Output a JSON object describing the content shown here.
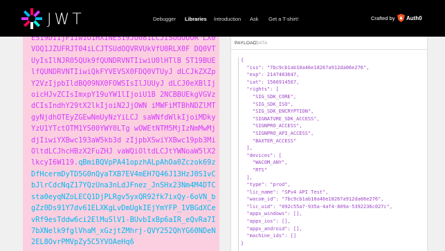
{
  "navbar": {
    "logo_text": "JWT",
    "links": [
      {
        "label": "Debugger"
      },
      {
        "label": "Libraries"
      },
      {
        "label": "Introduction"
      },
      {
        "label": "Ask"
      },
      {
        "label": "Get a T-shirt!"
      }
    ],
    "crafted_by": "Crafted by",
    "brand": "Auth0"
  },
  "encoded_token": {
    "payload_part": "ES19DIIjF1iw1O1HXINES19JU081LCJISUdOUOR LX0VOQ1JZUFRJT04iLCJTSUdOQVRVUkVfU0RLX0F DQ0VTUyIsIlNJR05QUk9fQUNDRVNTIiwiU0lHTlB ST19BUElfQUNDRVNTIiwiQkFYVEVSX0FDQ0VTUyJ dLCJkZXZpY2VzIjpbIldBQ09NX0FOWSIsIlJUUyJ dLCJ0eXBlIjoicHJvZCIsImxpY19uYW1lIjoiU1B 2NCBBUEkgVGVzdCIsIndhY29tX2lkIjoiN2JjOWN iMWFiMTBhNDZlMTgyNjdhOTEyZGEwNmUyNzYiLCJ saWNfdWlkIjoiMDkyYzU1YTctOTM1YS00YWY0LTg wOWEtNTM5MjIzNmMwMjdjIiwiYXBwc193aW5kb3d zIjpbXSwiYXBwc19pb3MiOltdLCJhcHBzX2FuZHJ vaWQiOltdLCJtYWNoaW5lX2lkcyI6W119.",
    "signature_part": "qBmiBQVpPA41opzhALpAhOa0Zczok69zDfHcermDyTD5G0nQyaTXB7EV4mEH7Q46J13HzJ0S1vCbJlrCdcNqZ17YQzUna3nLdJFnez_JnSHx23Nm4M4DTCsta0eyqNZoLECQ1DjPLRgv5yxQR92fk7ixQy-6oVN_bgZz0Ds91Y7dv61ELXKgLvDmUgkIEjYmYFP_1VBGdXCevRf9esTddw6ci2ElMuSlV1-BUvbIxBp6aIR_eQvRa7I7bXNelk9fglVhaM_xGzjtZMhrj-QVY252QhYG60NDeN2EL8OvrPMVpZy5C5YVOAeHq6"
  },
  "decoded": {
    "section_title": "PAYLOAD:",
    "section_sub": "DATA",
    "lines": [
      "{",
      "  \"iss\": \"7bc9cb1ab10a46e18267a912da06e276\",",
      "  \"exp\": 2147483647,",
      "  \"iat\": 1566914567,",
      "  \"rights\": [",
      "    \"SIG_SDK_CORE\",",
      "    \"SIG_SDK_ISO\",",
      "    \"SIG_SDK_ENCRYPTION\",",
      "    \"SIGNATURE_SDK_ACCESS\",",
      "    \"SIGNPRO_ACCESS\",",
      "    \"SIGNPRO_API_ACCESS\",",
      "    \"BAXTER_ACCESS\"",
      "  ],",
      "  \"devices\": [",
      "    \"WACOM_ANY\",",
      "    \"RTS\"",
      "  ],",
      "  \"type\": \"prod\",",
      "  \"lic_name\": \"SPv4 API Test\",",
      "  \"wacom_id\": \"7bc9cb1ab10a46e18267a912da06e276\",",
      "  \"lic_uid\": \"092c55a7-935a-4af4-809a-5392236c027c\",",
      "  \"apps_windows\": [],",
      "  \"apps_ios\": [],",
      "  \"apps_android\": [],",
      "  \"machine_ids\": []",
      "}"
    ]
  },
  "colors": {
    "navbar_bg": "#000000",
    "encoded_bg": "#fbcfe0",
    "payload_color": "#d63aff",
    "signature_color": "#00b9f1",
    "json_color": "#9c44c6"
  }
}
